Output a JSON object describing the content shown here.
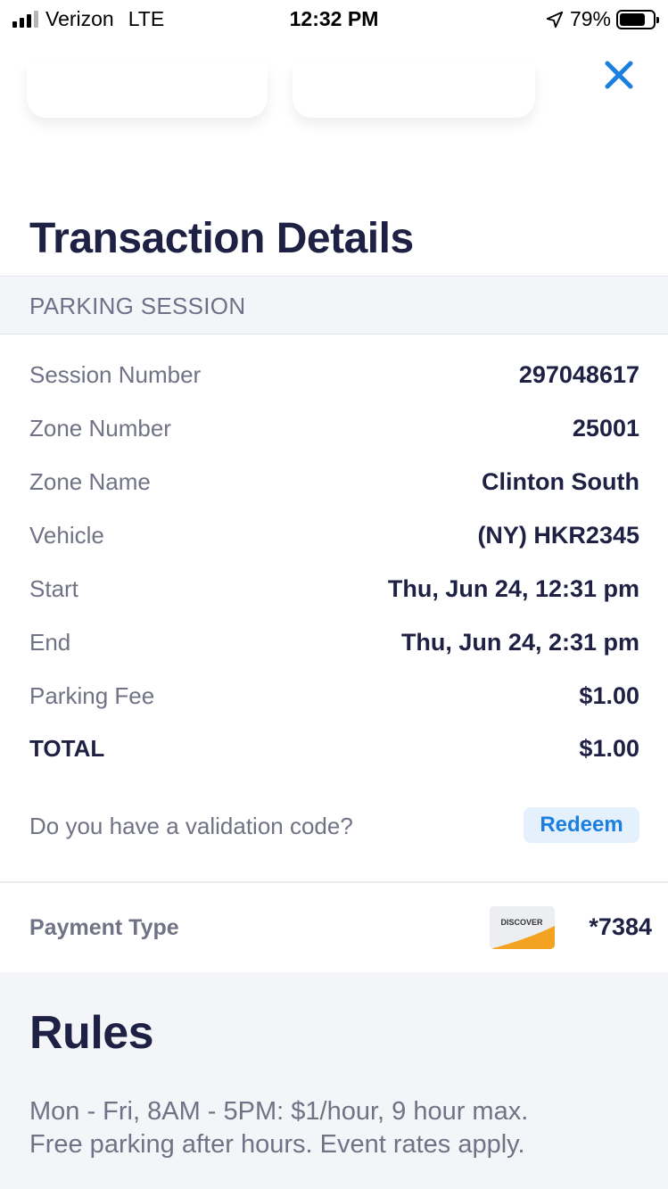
{
  "status_bar": {
    "carrier": "Verizon",
    "network": "LTE",
    "time": "12:32 PM",
    "battery": "79%",
    "battery_level": 0.79,
    "signal_bars_filled": 3,
    "signal_bars_total": 4
  },
  "page": {
    "title": "Transaction Details",
    "section_header": "PARKING SESSION",
    "close_icon": "close-icon",
    "accent_color": "#1c7fe0"
  },
  "details": [
    {
      "label": "Session Number",
      "value": "297048617"
    },
    {
      "label": "Zone Number",
      "value": "25001"
    },
    {
      "label": "Zone Name",
      "value": "Clinton South"
    },
    {
      "label": "Vehicle",
      "value": "(NY) HKR2345"
    },
    {
      "label": "Start",
      "value": "Thu, Jun 24, 12:31 pm"
    },
    {
      "label": "End",
      "value": "Thu, Jun 24, 2:31 pm"
    },
    {
      "label": "Parking Fee",
      "value": "$1.00"
    }
  ],
  "total": {
    "label": "TOTAL",
    "value": "$1.00"
  },
  "validation": {
    "prompt": "Do you have a validation code?",
    "redeem_label": "Redeem"
  },
  "payment": {
    "label": "Payment Type",
    "card_brand": "DISCOVER",
    "card_last4": "*7384"
  },
  "rules": {
    "title": "Rules",
    "text_line1": "Mon - Fri, 8AM - 5PM: $1/hour, 9 hour max.",
    "text_line2": "Free parking after hours. Event rates apply."
  }
}
